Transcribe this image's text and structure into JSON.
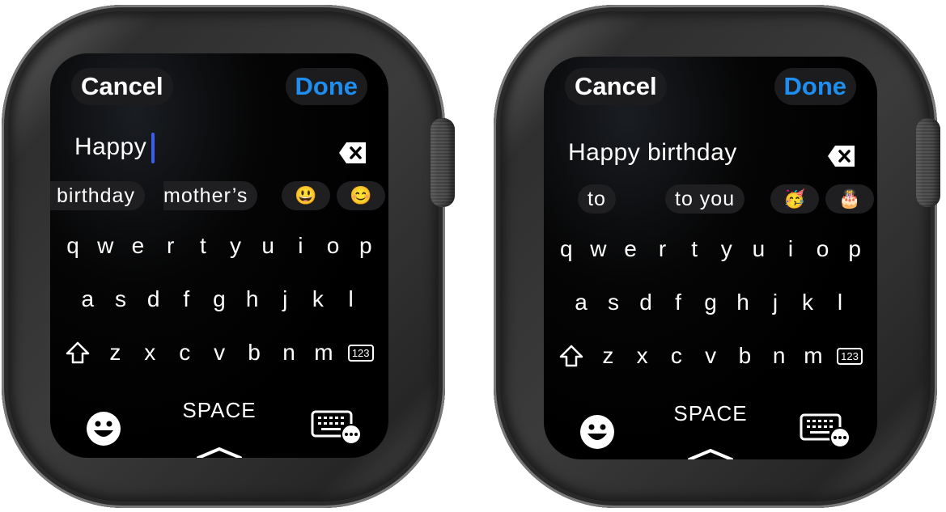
{
  "screens": [
    {
      "id": "left",
      "cancel_label": "Cancel",
      "done_label": "Done",
      "text_value": "Happy",
      "suggestions": [
        {
          "label": "birthday",
          "type": "word"
        },
        {
          "label": "mother’s",
          "type": "word"
        },
        {
          "label": "😃",
          "type": "emoji"
        },
        {
          "label": "😊",
          "type": "emoji"
        }
      ],
      "space_label": "SPACE"
    },
    {
      "id": "right",
      "cancel_label": "Cancel",
      "done_label": "Done",
      "text_value": "Happy birthday",
      "suggestions": [
        {
          "label": "to",
          "type": "word"
        },
        {
          "label": "to you",
          "type": "word"
        },
        {
          "label": "🥳",
          "type": "emoji"
        },
        {
          "label": "🎂",
          "type": "emoji"
        }
      ],
      "space_label": "SPACE"
    }
  ],
  "keyboard": {
    "row1": [
      "q",
      "w",
      "e",
      "r",
      "t",
      "y",
      "u",
      "i",
      "o",
      "p"
    ],
    "row2": [
      "a",
      "s",
      "d",
      "f",
      "g",
      "h",
      "j",
      "k",
      "l"
    ],
    "row3": [
      "z",
      "x",
      "c",
      "v",
      "b",
      "n",
      "m"
    ],
    "numbers_key": "123"
  },
  "icons": {
    "shift": "shift-icon",
    "backspace": "backspace-icon",
    "emoji": "emoji-icon",
    "keyboard_more": "keyboard-more-icon",
    "chevron": "chevron-up-icon"
  },
  "colors": {
    "accent": "#1e8ef0",
    "caret": "#3a5ef0",
    "pill": "#1f1f21"
  }
}
